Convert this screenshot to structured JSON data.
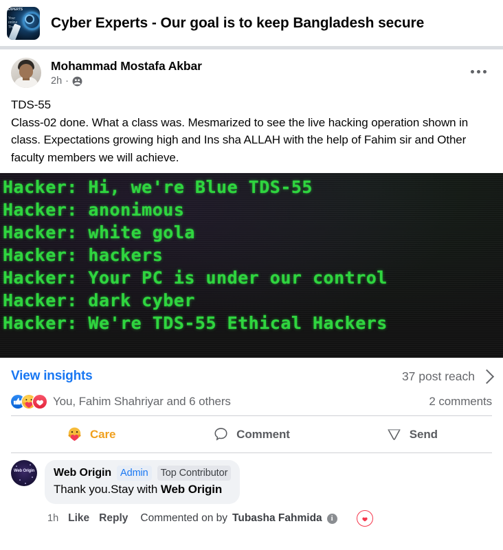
{
  "group": {
    "name": "Cyber Experts - Our goal is to keep Bangladesh secure",
    "avatar_label_top": "EXPERTS",
    "avatar_label_sub": "Your\nonline\nThreat",
    "avatar_icon": "group-cyber-avatar"
  },
  "post": {
    "author": "Mohammad Mostafa Akbar",
    "timestamp": "2h",
    "separator": "·",
    "audience_icon": "group-privacy-icon",
    "more_icon": "more-options-icon",
    "body_line_1": "TDS-55",
    "body_line_2": "Class-02 done. What a class was. Mesmarized to see the live hacking operation shown in class. Expectations growing high and Ins sha ALLAH with the help of Fahim sir and Other faculty members we will achieve.",
    "image": {
      "alt": "hacker-terminal-screenshot",
      "background": "#121212",
      "text_color": "#2fd53f",
      "lines": [
        "Hacker: Hi, we're Blue TDS-55",
        "Hacker: anonimous",
        "Hacker: white gola",
        "Hacker: hackers",
        "Hacker: Your PC is under our control",
        "Hacker: dark cyber",
        "Hacker: We're TDS-55 Ethical Hackers"
      ]
    }
  },
  "insights": {
    "link_label": "View insights",
    "link_color": "#1877f2",
    "reach_label": "37 post reach",
    "chevron_icon": "chevron-right-icon"
  },
  "reactions": {
    "icons": [
      "like-icon",
      "care-icon",
      "love-icon"
    ],
    "summary": "You, Fahim Shahriyar and 6 others",
    "comment_count": "2 comments"
  },
  "actions": [
    {
      "label": "Care",
      "icon": "care-icon",
      "active": true,
      "color": "#f0a01e"
    },
    {
      "label": "Comment",
      "icon": "comment-icon",
      "active": false,
      "color": "#5a5c60"
    },
    {
      "label": "Send",
      "icon": "send-icon",
      "active": false,
      "color": "#5a5c60"
    }
  ],
  "comment": {
    "avatar_label": "Web Origin",
    "author": "Web Origin",
    "badge_admin": "Admin",
    "badge_top": "Top Contributor",
    "text_plain": "Thank you.Stay with ",
    "text_bold": "Web Origin",
    "timestamp": "1h",
    "like_label": "Like",
    "reply_label": "Reply",
    "commented_on_prefix": "Commented on by ",
    "commented_on_name": "Tubasha Fahmida",
    "info_icon": "info-icon",
    "reaction_icon": "love-icon"
  }
}
